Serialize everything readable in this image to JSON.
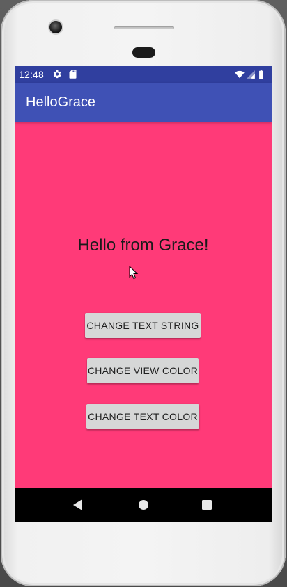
{
  "status_bar": {
    "time": "12:48",
    "left_icons": [
      "gear-icon",
      "sd-card-icon"
    ],
    "right_icons": [
      "wifi-icon",
      "cell-signal-icon",
      "battery-icon"
    ]
  },
  "app_bar": {
    "title": "HelloGrace"
  },
  "main": {
    "greeting": "Hello from Grace!",
    "background_color": "#ff3a78",
    "buttons": [
      {
        "label": "CHANGE TEXT STRING"
      },
      {
        "label": "CHANGE VIEW COLOR"
      },
      {
        "label": "CHANGE TEXT COLOR"
      }
    ]
  },
  "nav_bar": {
    "icons": [
      "back-icon",
      "home-icon",
      "recents-icon"
    ]
  },
  "colors": {
    "status_bar": "#303f9f",
    "app_bar": "#3f51b5",
    "button": "#d6d7d7"
  }
}
